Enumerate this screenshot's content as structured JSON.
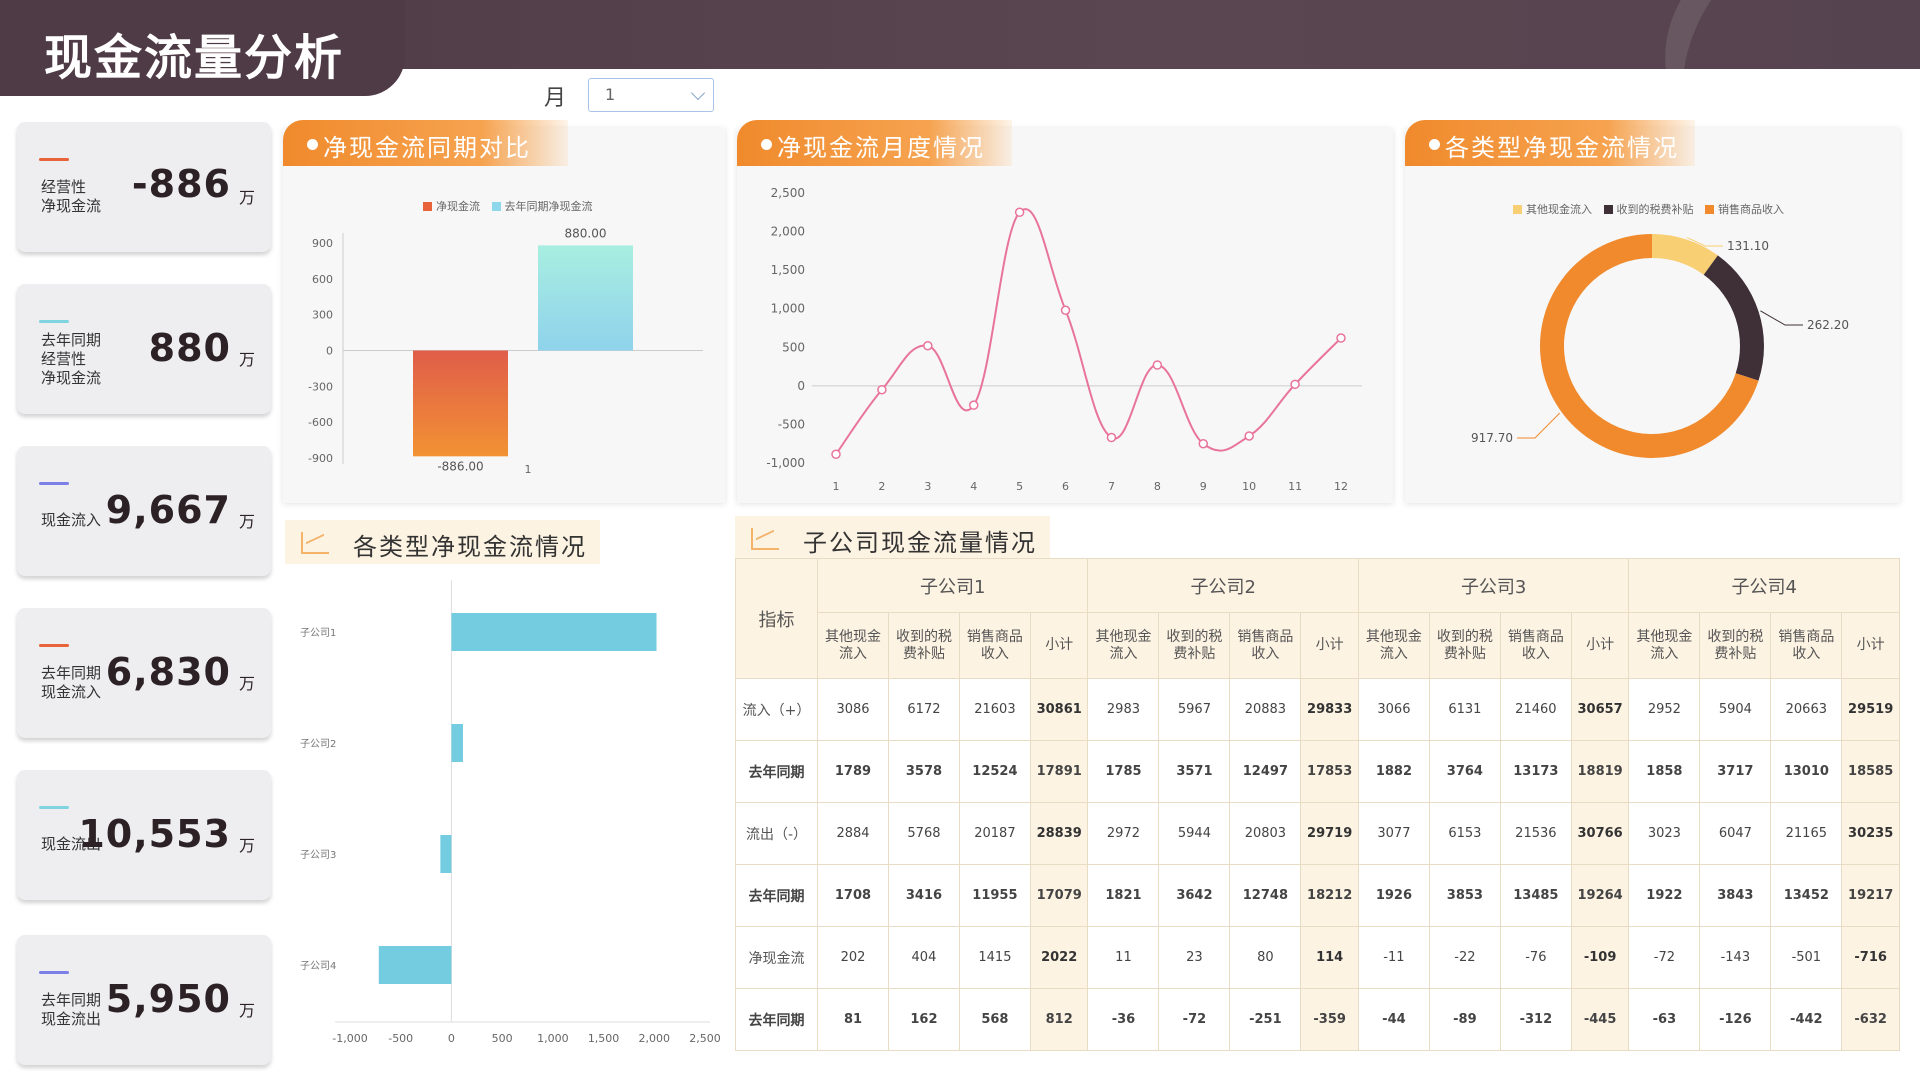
{
  "header": {
    "title": "现金流量分析"
  },
  "filter": {
    "label": "月",
    "value": "1"
  },
  "kpis": [
    {
      "label": "经营性\n净现金流",
      "value": "-886",
      "unit": "万",
      "color": "#e8623a"
    },
    {
      "label": "去年同期\n经营性\n净现金流",
      "value": "880",
      "unit": "万",
      "color": "#7fd4e0"
    },
    {
      "label": "现金流入",
      "value": "9,667",
      "unit": "万",
      "color": "#7b7fe6"
    },
    {
      "label": "去年同期\n现金流入",
      "value": "6,830",
      "unit": "万",
      "color": "#e8623a"
    },
    {
      "label": "现金流出",
      "value": "10,553",
      "unit": "万",
      "color": "#7fd4e0"
    },
    {
      "label": "去年同期\n现金流出",
      "value": "5,950",
      "unit": "万",
      "color": "#7b7fe6"
    }
  ],
  "panels": {
    "yoy_title": "净现金流同期对比",
    "monthly_title": "净现金流月度情况",
    "types_title": "各类型净现金流情况",
    "sub_bar_title": "各类型净现金流情况",
    "table_title": "子公司现金流量情况"
  },
  "chart_data": [
    {
      "type": "bar",
      "legend": [
        "净现金流",
        "去年同期净现金流"
      ],
      "categories": [
        "1"
      ],
      "series": [
        {
          "name": "净现金流",
          "values": [
            -886.0
          ],
          "label": "-886.00",
          "color_top": "#e05d4a",
          "color_bottom": "#f29233"
        },
        {
          "name": "去年同期净现金流",
          "values": [
            880.0
          ],
          "label": "880.00",
          "color_top": "#a8eee0",
          "color_bottom": "#8fd3ec"
        }
      ],
      "yticks": [
        "900",
        "600",
        "300",
        "0",
        "-300",
        "-600",
        "-900"
      ],
      "ylim": [
        -900,
        900
      ]
    },
    {
      "type": "line",
      "x": [
        "1",
        "2",
        "3",
        "4",
        "5",
        "6",
        "7",
        "8",
        "9",
        "10",
        "11",
        "12"
      ],
      "values": [
        -886,
        -50,
        520,
        -250,
        2250,
        980,
        -670,
        270,
        -750,
        -650,
        20,
        620
      ],
      "yticks": [
        "2,500",
        "2,000",
        "1,500",
        "1,000",
        "500",
        "0",
        "-500",
        "-1,000"
      ],
      "ylim": [
        -1000,
        2500
      ],
      "color": "#e8749a"
    },
    {
      "type": "pie",
      "legend": [
        "其他现金流入",
        "收到的税费补贴",
        "销售商品收入"
      ],
      "values": [
        131.1,
        262.2,
        917.7
      ],
      "labels": [
        "131.10",
        "262.20",
        "917.70"
      ],
      "colors": [
        "#f8cf72",
        "#3e3036",
        "#f08a2c"
      ]
    },
    {
      "type": "bar",
      "orientation": "horizontal",
      "categories": [
        "子公司1",
        "子公司2",
        "子公司3",
        "子公司4"
      ],
      "values": [
        2022,
        114,
        -109,
        -716
      ],
      "xticks": [
        "-1,000",
        "-500",
        "0",
        "500",
        "1,000",
        "1,500",
        "2,000",
        "2,500"
      ],
      "xlim": [
        -1000,
        2500
      ],
      "color": "#74cce0"
    }
  ],
  "table": {
    "index_header": "指标",
    "companies": [
      "子公司1",
      "子公司2",
      "子公司3",
      "子公司4"
    ],
    "sub_headers": [
      "其他现金\n流入",
      "收到的税\n费补贴",
      "销售商品\n收入",
      "小计"
    ],
    "rows": [
      {
        "label": "流入（+）",
        "bold": false,
        "cells": [
          "3086",
          "6172",
          "21603",
          "30861",
          "2983",
          "5967",
          "20883",
          "29833",
          "3066",
          "6131",
          "21460",
          "30657",
          "2952",
          "5904",
          "20663",
          "29519"
        ]
      },
      {
        "label": "去年同期",
        "bold": true,
        "cells": [
          "1789",
          "3578",
          "12524",
          "17891",
          "1785",
          "3571",
          "12497",
          "17853",
          "1882",
          "3764",
          "13173",
          "18819",
          "1858",
          "3717",
          "13010",
          "18585"
        ]
      },
      {
        "label": "流出（-）",
        "bold": false,
        "cells": [
          "2884",
          "5768",
          "20187",
          "28839",
          "2972",
          "5944",
          "20803",
          "29719",
          "3077",
          "6153",
          "21536",
          "30766",
          "3023",
          "6047",
          "21165",
          "30235"
        ]
      },
      {
        "label": "去年同期",
        "bold": true,
        "cells": [
          "1708",
          "3416",
          "11955",
          "17079",
          "1821",
          "3642",
          "12748",
          "18212",
          "1926",
          "3853",
          "13485",
          "19264",
          "1922",
          "3843",
          "13452",
          "19217"
        ]
      },
      {
        "label": "净现金流",
        "bold": false,
        "cells": [
          "202",
          "404",
          "1415",
          "2022",
          "11",
          "23",
          "80",
          "114",
          "-11",
          "-22",
          "-76",
          "-109",
          "-72",
          "-143",
          "-501",
          "-716"
        ]
      },
      {
        "label": "去年同期",
        "bold": true,
        "cells": [
          "81",
          "162",
          "568",
          "812",
          "-36",
          "-72",
          "-251",
          "-359",
          "-44",
          "-89",
          "-312",
          "-445",
          "-63",
          "-126",
          "-442",
          "-632"
        ]
      }
    ]
  }
}
